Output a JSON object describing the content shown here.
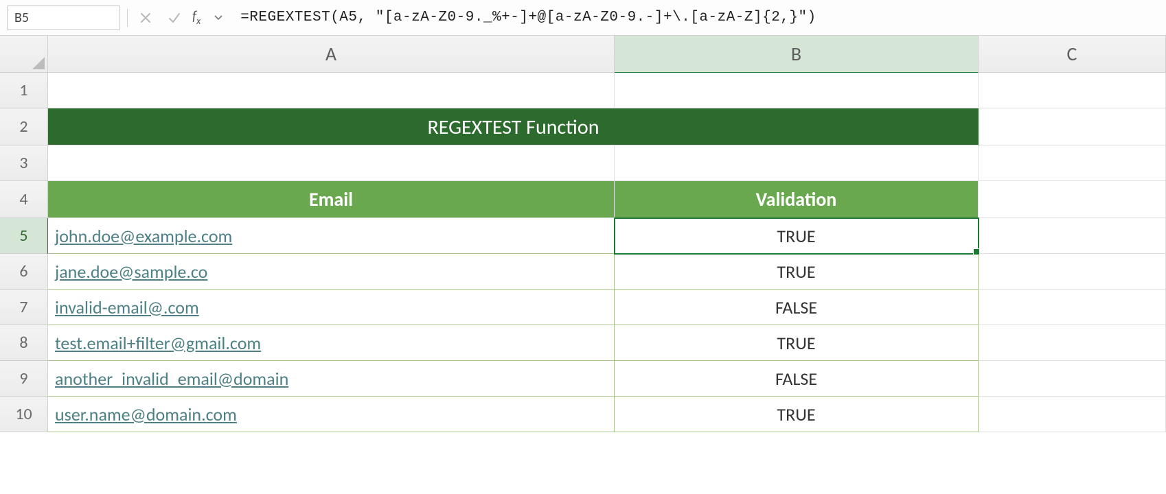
{
  "formula_bar": {
    "name_box": "B5",
    "formula": "=REGEXTEST(A5, \"[a-zA-Z0-9._%+-]+@[a-zA-Z0-9.-]+\\.[a-zA-Z]{2,}\")"
  },
  "columns": [
    "A",
    "B",
    "C"
  ],
  "rows": [
    "1",
    "2",
    "3",
    "4",
    "5",
    "6",
    "7",
    "8",
    "9",
    "10"
  ],
  "selected_cell": "B5",
  "title": "REGEXTEST Function",
  "headers": {
    "A": "Email",
    "B": "Validation"
  },
  "data": [
    {
      "email": "john.doe@example.com",
      "valid": "TRUE"
    },
    {
      "email": "jane.doe@sample.co",
      "valid": "TRUE"
    },
    {
      "email": "invalid-email@.com",
      "valid": "FALSE"
    },
    {
      "email": "test.email+filter@gmail.com",
      "valid": "TRUE"
    },
    {
      "email": "another_invalid_email@domain",
      "valid": "FALSE"
    },
    {
      "email": "user.name@domain.com",
      "valid": "TRUE"
    }
  ]
}
